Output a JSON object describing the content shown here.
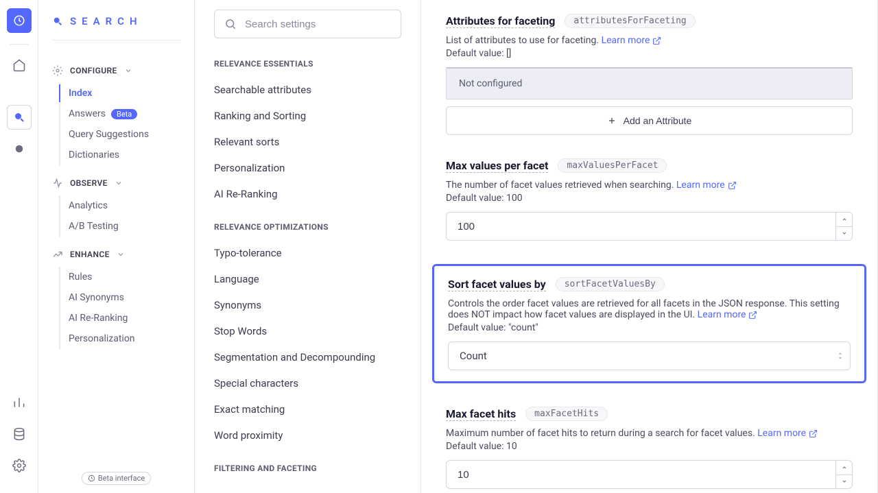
{
  "brand": {
    "title": "SEARCH"
  },
  "sidebar": {
    "configure": {
      "label": "CONFIGURE",
      "items": [
        "Index",
        "Answers",
        "Query Suggestions",
        "Dictionaries"
      ],
      "beta_label": "Beta"
    },
    "observe": {
      "label": "OBSERVE",
      "items": [
        "Analytics",
        "A/B Testing"
      ]
    },
    "enhance": {
      "label": "ENHANCE",
      "items": [
        "Rules",
        "AI Synonyms",
        "AI Re-Ranking",
        "Personalization"
      ]
    },
    "beta_interface": "Beta interface"
  },
  "search": {
    "placeholder": "Search settings"
  },
  "mid": {
    "relevance_essentials": {
      "header": "RELEVANCE ESSENTIALS",
      "items": [
        "Searchable attributes",
        "Ranking and Sorting",
        "Relevant sorts",
        "Personalization",
        "AI Re-Ranking"
      ]
    },
    "relevance_optimizations": {
      "header": "RELEVANCE OPTIMIZATIONS",
      "items": [
        "Typo-tolerance",
        "Language",
        "Synonyms",
        "Stop Words",
        "Segmentation and Decompounding",
        "Special characters",
        "Exact matching",
        "Word proximity"
      ]
    },
    "filtering_faceting": {
      "header": "FILTERING AND FACETING"
    }
  },
  "common": {
    "learn_more": "Learn more"
  },
  "attrs_faceting": {
    "title": "Attributes for faceting",
    "code": "attributesForFaceting",
    "desc": "List of attributes to use for faceting.",
    "default": "Default value: []",
    "not_configured": "Not configured",
    "add": "Add an Attribute"
  },
  "max_values": {
    "title": "Max values per facet",
    "code": "maxValuesPerFacet",
    "desc": "The number of facet values retrieved when searching.",
    "default": "Default value: 100",
    "value": "100"
  },
  "sort_facet": {
    "title": "Sort facet values by",
    "code": "sortFacetValuesBy",
    "desc": "Controls the order facet values are retrieved for all facets in the JSON response. This setting does NOT impact how facet values are displayed in the UI.",
    "default": "Default value: \"count\"",
    "value": "Count"
  },
  "max_hits": {
    "title": "Max facet hits",
    "code": "maxFacetHits",
    "desc": "Maximum number of facet hits to return during a search for facet values.",
    "default": "Default value: 10",
    "value": "10"
  }
}
